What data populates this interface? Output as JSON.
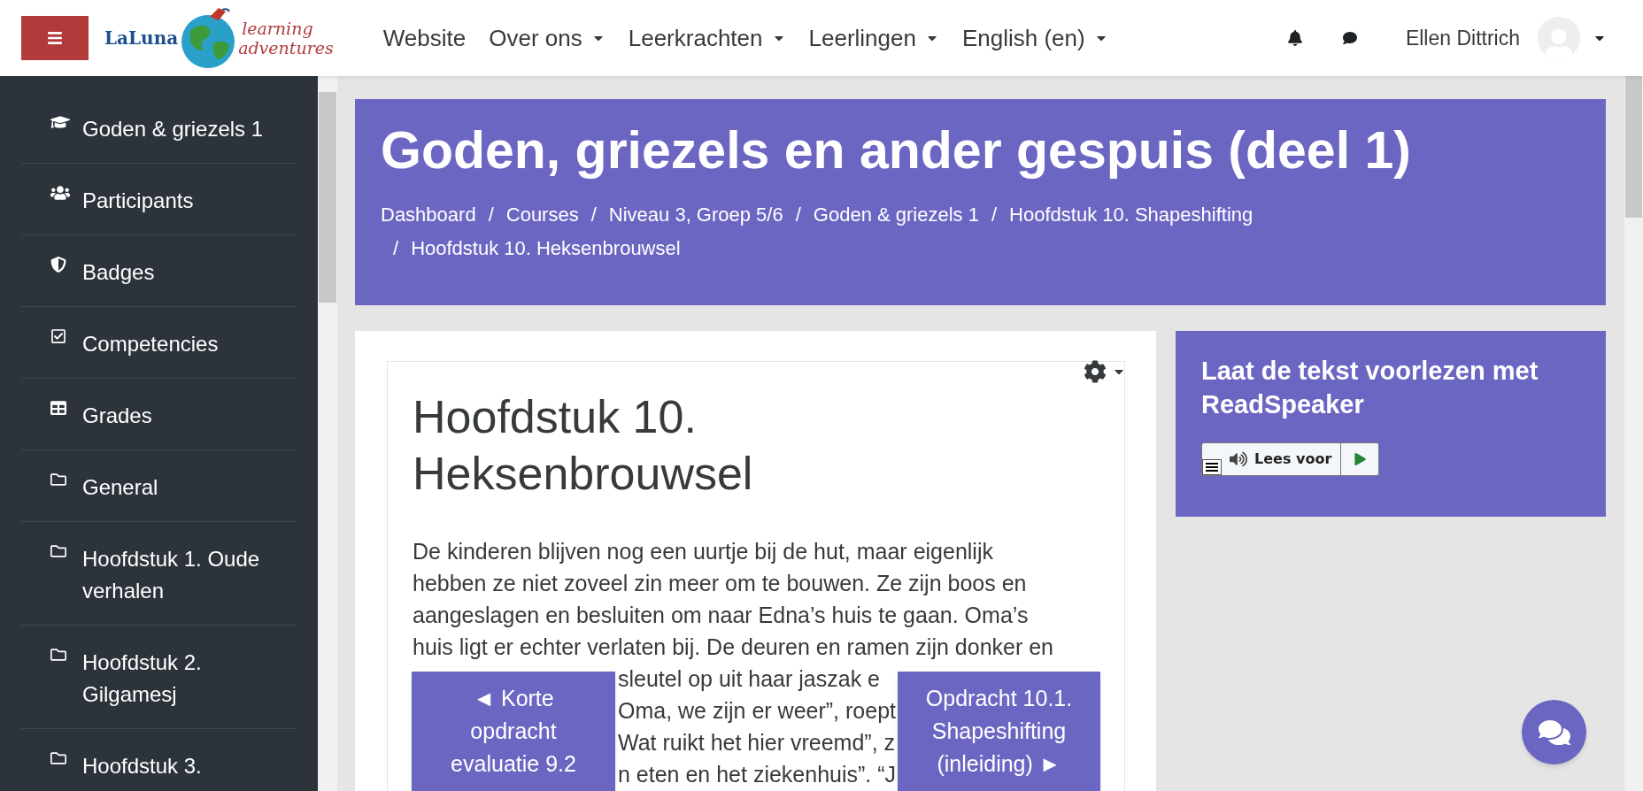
{
  "header": {
    "logo": {
      "brand": "LaLuna",
      "tagline_1": "learning",
      "tagline_2": "adventures"
    },
    "nav": [
      {
        "label": "Website",
        "dropdown": false
      },
      {
        "label": "Over ons",
        "dropdown": true
      },
      {
        "label": "Leerkrachten",
        "dropdown": true
      },
      {
        "label": "Leerlingen",
        "dropdown": true
      },
      {
        "label": "English (en)",
        "dropdown": true
      }
    ],
    "user_name": "Ellen Dittrich"
  },
  "sidebar": {
    "items": [
      {
        "kind": "course",
        "label": "Goden & griezels 1"
      },
      {
        "kind": "participants",
        "label": "Participants"
      },
      {
        "kind": "badges",
        "label": "Badges"
      },
      {
        "kind": "competencies",
        "label": "Competencies"
      },
      {
        "kind": "grades",
        "label": "Grades"
      },
      {
        "kind": "section",
        "label": "General"
      },
      {
        "kind": "section",
        "label": "Hoofdstuk 1. Oude verhalen"
      },
      {
        "kind": "section",
        "label": "Hoofdstuk 2. Gilgamesj"
      },
      {
        "kind": "section",
        "label": "Hoofdstuk 3."
      }
    ]
  },
  "page_header": {
    "title": "Goden, griezels en ander gespuis (deel 1)",
    "separator": "/",
    "breadcrumb": [
      "Dashboard",
      "Courses",
      "Niveau 3, Groep 5/6",
      "Goden & griezels 1",
      "Hoofdstuk 10. Shapeshifting",
      "Hoofdstuk 10. Heksenbrouwsel"
    ]
  },
  "content": {
    "heading": "Hoofdstuk 10. Heksenbrouwsel",
    "lines": [
      {
        "kind": "full",
        "text": "De kinderen blijven nog een uurtje bij de hut, maar eigenlijk"
      },
      {
        "kind": "full",
        "text": "hebben ze niet zoveel zin meer om te bouwen. Ze zijn boos en"
      },
      {
        "kind": "full",
        "text": "aangeslagen en besluiten om naar Edna’s huis te gaan. Oma’s"
      },
      {
        "kind": "full",
        "text": "huis ligt er echter verlaten bij. De deuren en ramen zijn donker en"
      },
      {
        "kind": "partial",
        "text": "sleutel op uit haar jaszak e"
      },
      {
        "kind": "partial",
        "text": "Oma, we zijn er weer”, roept"
      },
      {
        "kind": "partial",
        "text": "Wat ruikt het hier vreemd”, z"
      },
      {
        "kind": "partial",
        "text": "n eten en het ziekenhuis”. “J"
      }
    ]
  },
  "readspeaker": {
    "title": "Laat de tekst voorlezen met ReadSpeaker",
    "button": "Lees voor"
  },
  "page_nav": {
    "previous": "◄ Korte opdracht evaluatie 9.2",
    "next": "Opdracht 10.1. Shapeshifting (inleiding) ►"
  }
}
